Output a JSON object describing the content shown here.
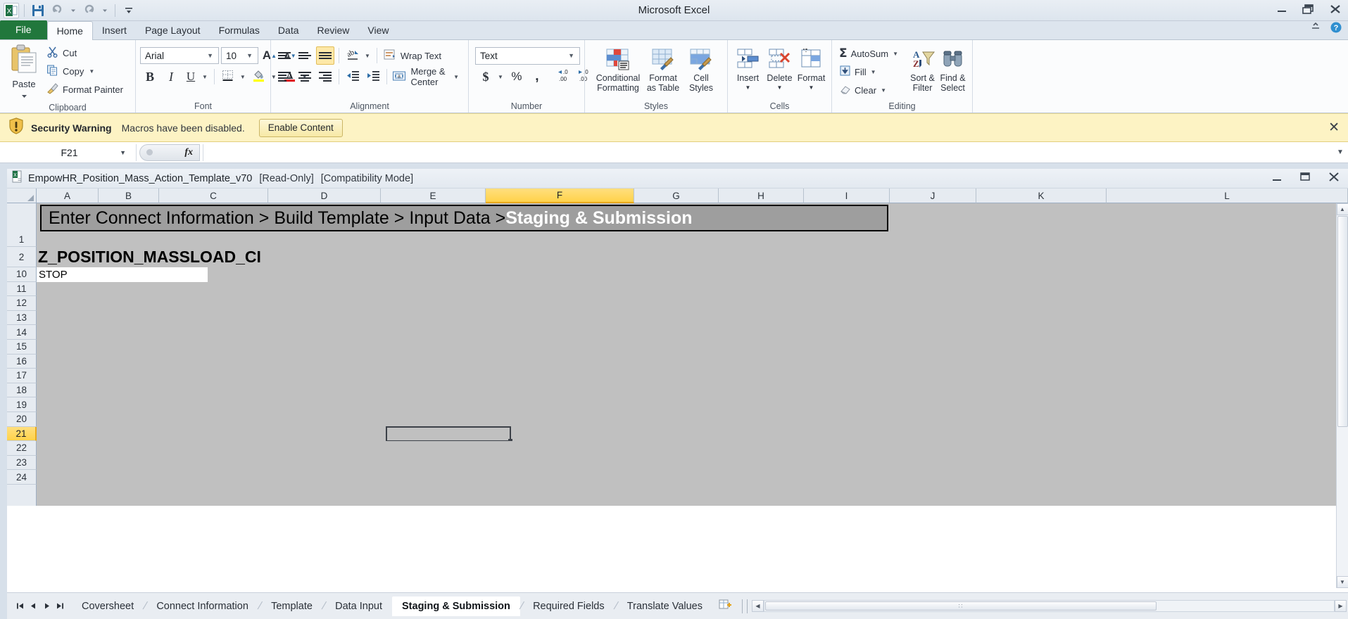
{
  "window": {
    "app_title": "Microsoft Excel",
    "minimize": "–",
    "restore": "❐",
    "close": "✕"
  },
  "quick_access": {
    "save_title": "Save",
    "undo_title": "Undo",
    "redo_title": "Redo",
    "customize_title": "Customize Quick Access Toolbar"
  },
  "ribbon_tabs": [
    {
      "label": "File",
      "active": false
    },
    {
      "label": "Home",
      "active": true
    },
    {
      "label": "Insert",
      "active": false
    },
    {
      "label": "Page Layout",
      "active": false
    },
    {
      "label": "Formulas",
      "active": false
    },
    {
      "label": "Data",
      "active": false
    },
    {
      "label": "Review",
      "active": false
    },
    {
      "label": "View",
      "active": false
    }
  ],
  "ribbon": {
    "clipboard": {
      "group_label": "Clipboard",
      "paste_label": "Paste",
      "cut_label": "Cut",
      "copy_label": "Copy",
      "format_painter_label": "Format Painter"
    },
    "font": {
      "group_label": "Font",
      "font_name": "Arial",
      "font_size": "10",
      "grow_font": "A",
      "shrink_font": "A",
      "bold": "B",
      "italic": "I",
      "underline": "U"
    },
    "alignment": {
      "group_label": "Alignment",
      "wrap_text_label": "Wrap Text",
      "merge_center_label": "Merge & Center",
      "orientation_label": "Orientation"
    },
    "number": {
      "group_label": "Number",
      "format_value": "Text",
      "currency": "$",
      "percent": "%",
      "comma": ","
    },
    "styles": {
      "group_label": "Styles",
      "conditional_formatting": "Conditional\nFormatting",
      "conditional_formatting_l1": "Conditional",
      "conditional_formatting_l2": "Formatting",
      "format_as_table_l1": "Format",
      "format_as_table_l2": "as Table",
      "cell_styles_l1": "Cell",
      "cell_styles_l2": "Styles"
    },
    "cells": {
      "group_label": "Cells",
      "insert_label": "Insert",
      "delete_label": "Delete",
      "format_label": "Format"
    },
    "editing": {
      "group_label": "Editing",
      "autosum_label": "AutoSum",
      "fill_label": "Fill",
      "clear_label": "Clear",
      "sort_filter_l1": "Sort &",
      "sort_filter_l2": "Filter",
      "find_select_l1": "Find &",
      "find_select_l2": "Select"
    }
  },
  "security_bar": {
    "title": "Security Warning",
    "message": "Macros have been disabled.",
    "button": "Enable Content",
    "close": "✕"
  },
  "formula_bar": {
    "name_box_value": "F21",
    "fx_label": "fx",
    "formula_value": ""
  },
  "document": {
    "title": "EmpowHR_Position_Mass_Action_Template_v70",
    "read_only": "[Read-Only]",
    "compatibility": "[Compatibility Mode]",
    "minimize": "–",
    "restore": "❐",
    "close": "✕"
  },
  "grid": {
    "columns": [
      "A",
      "B",
      "C",
      "D",
      "E",
      "F",
      "G",
      "H",
      "I",
      "J",
      "K",
      "L"
    ],
    "selected_column": "F",
    "rows": [
      "1",
      "2",
      "10",
      "11",
      "12",
      "13",
      "14",
      "15",
      "16",
      "17",
      "18",
      "19",
      "20",
      "21",
      "22",
      "23",
      "24"
    ],
    "selected_row": "21",
    "selected_cell": "F21",
    "banner": {
      "prefix": "Enter Connect Information > Build Template > Input Data > ",
      "highlight": "Staging & Submission"
    },
    "cell_a2": "Z_POSITION_MASSLOAD_CI",
    "cell_a10": "STOP"
  },
  "sheet_tabs": {
    "first_label": "First Sheet",
    "prev_label": "Previous Sheet",
    "next_label": "Next Sheet",
    "last_label": "Last Sheet",
    "items": [
      {
        "label": "Coversheet",
        "active": false
      },
      {
        "label": "Connect Information",
        "active": false
      },
      {
        "label": "Template",
        "active": false
      },
      {
        "label": "Data Input",
        "active": false
      },
      {
        "label": "Staging & Submission",
        "active": true
      },
      {
        "label": "Required Fields",
        "active": false
      },
      {
        "label": "Translate Values",
        "active": false
      }
    ],
    "insert_sheet_label": "Insert Worksheet"
  },
  "colors": {
    "excel_green": "#21773c",
    "selection_orange": "#ffd24a",
    "warning_yellow": "#fdf3c4",
    "grid_gray": "#c0c0c0",
    "banner_gray": "#9e9e9e"
  }
}
